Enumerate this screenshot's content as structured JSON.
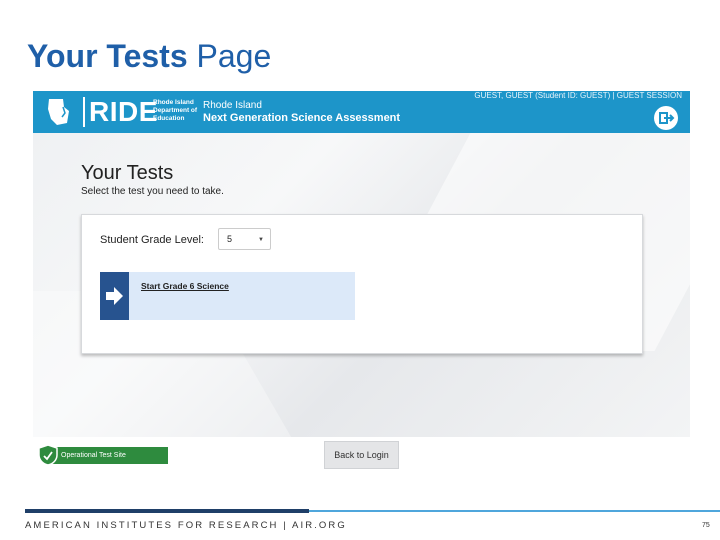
{
  "slide": {
    "title_bold": "Your Tests",
    "title_rest": " Page"
  },
  "header": {
    "brand": "RIDE",
    "dept": "Rhode Island Department of Education",
    "state": "Rhode Island",
    "assessment": "Next Generation Science Assessment",
    "guest_info": "GUEST, GUEST (Student ID: GUEST) | GUEST SESSION",
    "colors": {
      "header_bg": "#1d95c9",
      "card_bg": "#dce9f9",
      "arrow_bg": "#27538f"
    },
    "icons": [
      "rhode-island-map-icon",
      "logout-icon"
    ]
  },
  "main": {
    "heading": "Your Tests",
    "subheading": "Select the test you need to take.",
    "grade_label": "Student Grade Level:",
    "grade_value": "5",
    "test_button": "Start Grade 6 Science",
    "op_test_site": "Operational Test Site",
    "back_to_login": "Back to Login"
  },
  "footer": {
    "org": "AMERICAN INSTITUTES FOR RESEARCH | AIR.ORG",
    "page": "75"
  }
}
